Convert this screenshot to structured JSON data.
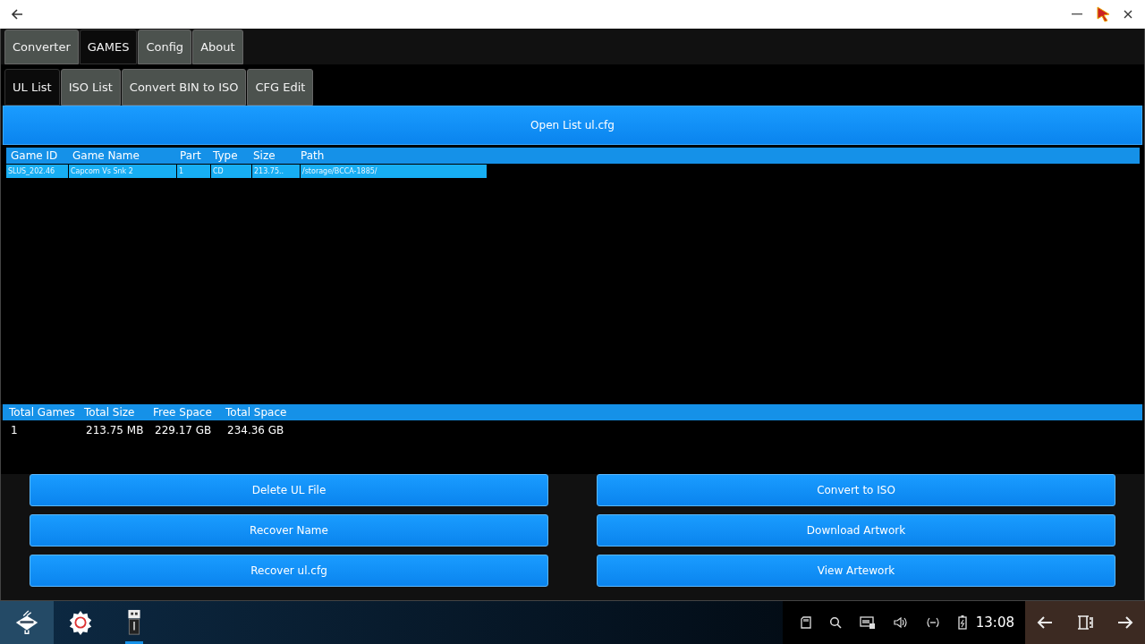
{
  "tabs": [
    {
      "label": "Converter",
      "selected": false
    },
    {
      "label": "GAMES",
      "selected": true
    },
    {
      "label": "Config",
      "selected": false
    },
    {
      "label": "About",
      "selected": false
    }
  ],
  "subtabs": [
    {
      "label": "UL List",
      "selected": true
    },
    {
      "label": "ISO List",
      "selected": false
    },
    {
      "label": "Convert BIN to ISO",
      "selected": false
    },
    {
      "label": "CFG Edit",
      "selected": false
    }
  ],
  "open_button": "Open List ul.cfg",
  "games_table": {
    "columns": [
      "Game ID",
      "Game Name",
      "Part",
      "Type",
      "Size",
      "Path"
    ],
    "rows": [
      {
        "selected": true,
        "cells": [
          "SLUS_202.46",
          "Capcom Vs Snk 2",
          "1",
          "CD",
          "213.75..",
          "/storage/BCCA-1885/"
        ]
      }
    ]
  },
  "summary": {
    "columns": [
      "Total Games",
      "Total Size",
      "Free Space",
      "Total Space"
    ],
    "values": [
      "1",
      "213.75 MB",
      "229.17 GB",
      "234.36 GB"
    ]
  },
  "actions": [
    [
      "Delete UL File",
      "Recover Name",
      "Recover ul.cfg"
    ],
    [
      "Convert to ISO",
      "Download Artwork",
      "View Artework"
    ]
  ],
  "taskbar": {
    "apps": [
      {
        "kind": "launcher",
        "selected": true,
        "running": false
      },
      {
        "kind": "gear",
        "selected": false,
        "running": false
      },
      {
        "kind": "usb",
        "selected": false,
        "running": true
      }
    ],
    "clock": "13:08"
  }
}
